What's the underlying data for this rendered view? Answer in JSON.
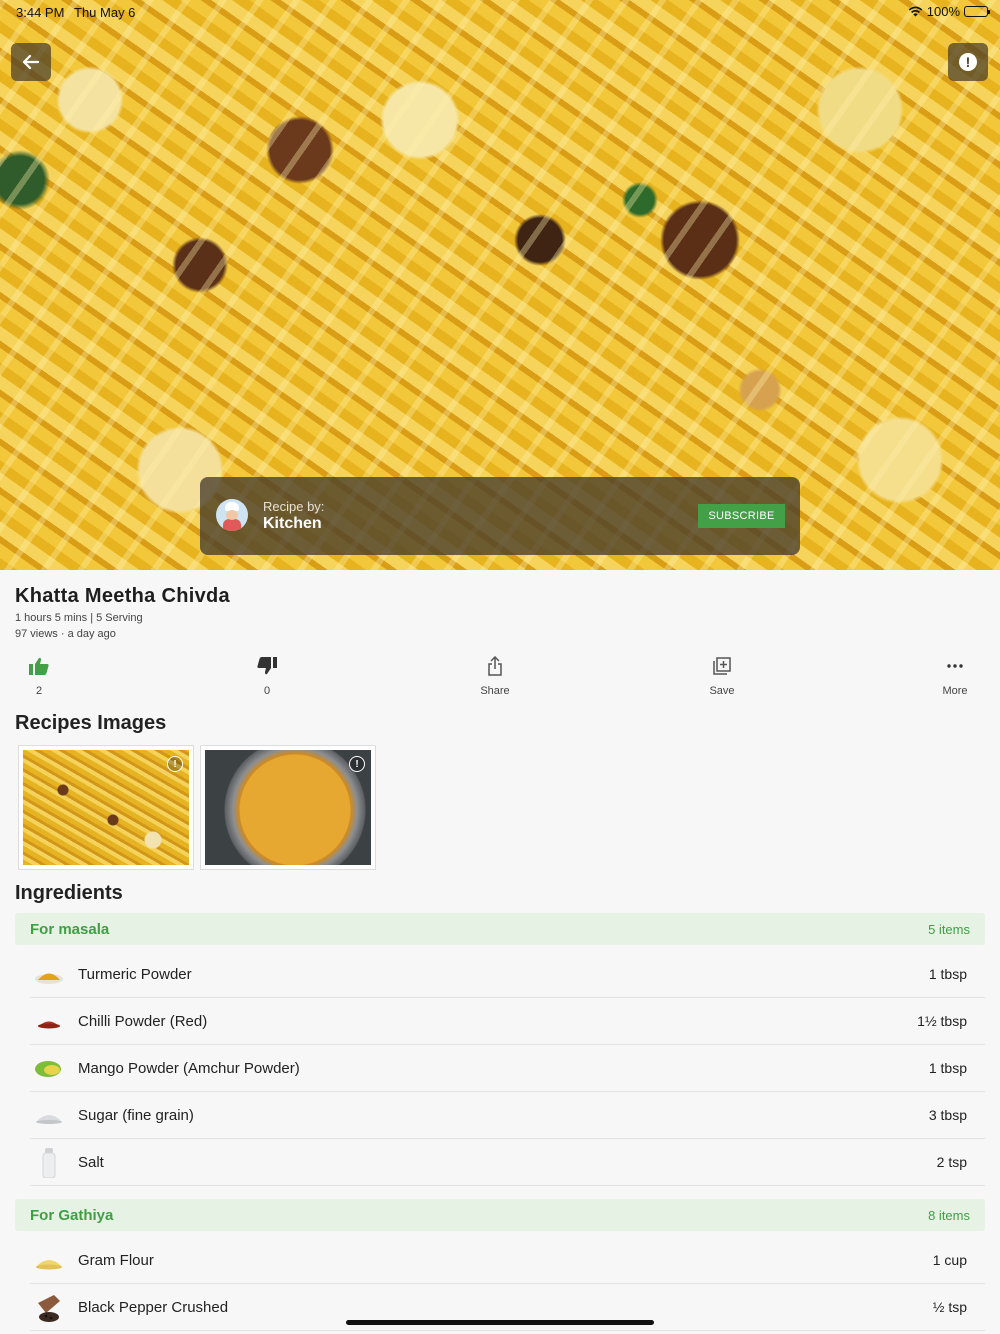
{
  "status": {
    "time": "3:44 PM",
    "date": "Thu May 6",
    "battery": "100%"
  },
  "recipe_by": {
    "label": "Recipe by:",
    "name": "Kitchen",
    "subscribe": "SUBSCRIBE"
  },
  "recipe": {
    "title": "Khatta Meetha Chivda",
    "meta_time_serving": "1 hours 5 mins | 5 Serving",
    "meta_views": "97 views · a day ago"
  },
  "actions": {
    "like_count": "2",
    "dislike_count": "0",
    "share": "Share",
    "save": "Save",
    "more": "More"
  },
  "recipes_images_title": "Recipes Images",
  "ingredients_title": "Ingredients",
  "groups": [
    {
      "name": "For masala",
      "count": "5 items",
      "items": [
        {
          "name": "Turmeric Powder",
          "qty": "1 tbsp"
        },
        {
          "name": "Chilli Powder (Red)",
          "qty": "1½ tbsp"
        },
        {
          "name": "Mango Powder (Amchur Powder)",
          "qty": "1 tbsp"
        },
        {
          "name": "Sugar (fine grain)",
          "qty": "3 tbsp"
        },
        {
          "name": "Salt",
          "qty": "2 tsp"
        }
      ]
    },
    {
      "name": "For Gathiya",
      "count": "8 items",
      "items": [
        {
          "name": "Gram Flour",
          "qty": "1 cup"
        },
        {
          "name": "Black Pepper Crushed",
          "qty": "½ tsp"
        }
      ]
    }
  ],
  "colors": {
    "accent": "#43a047",
    "group_bg": "#e6f2e4"
  }
}
